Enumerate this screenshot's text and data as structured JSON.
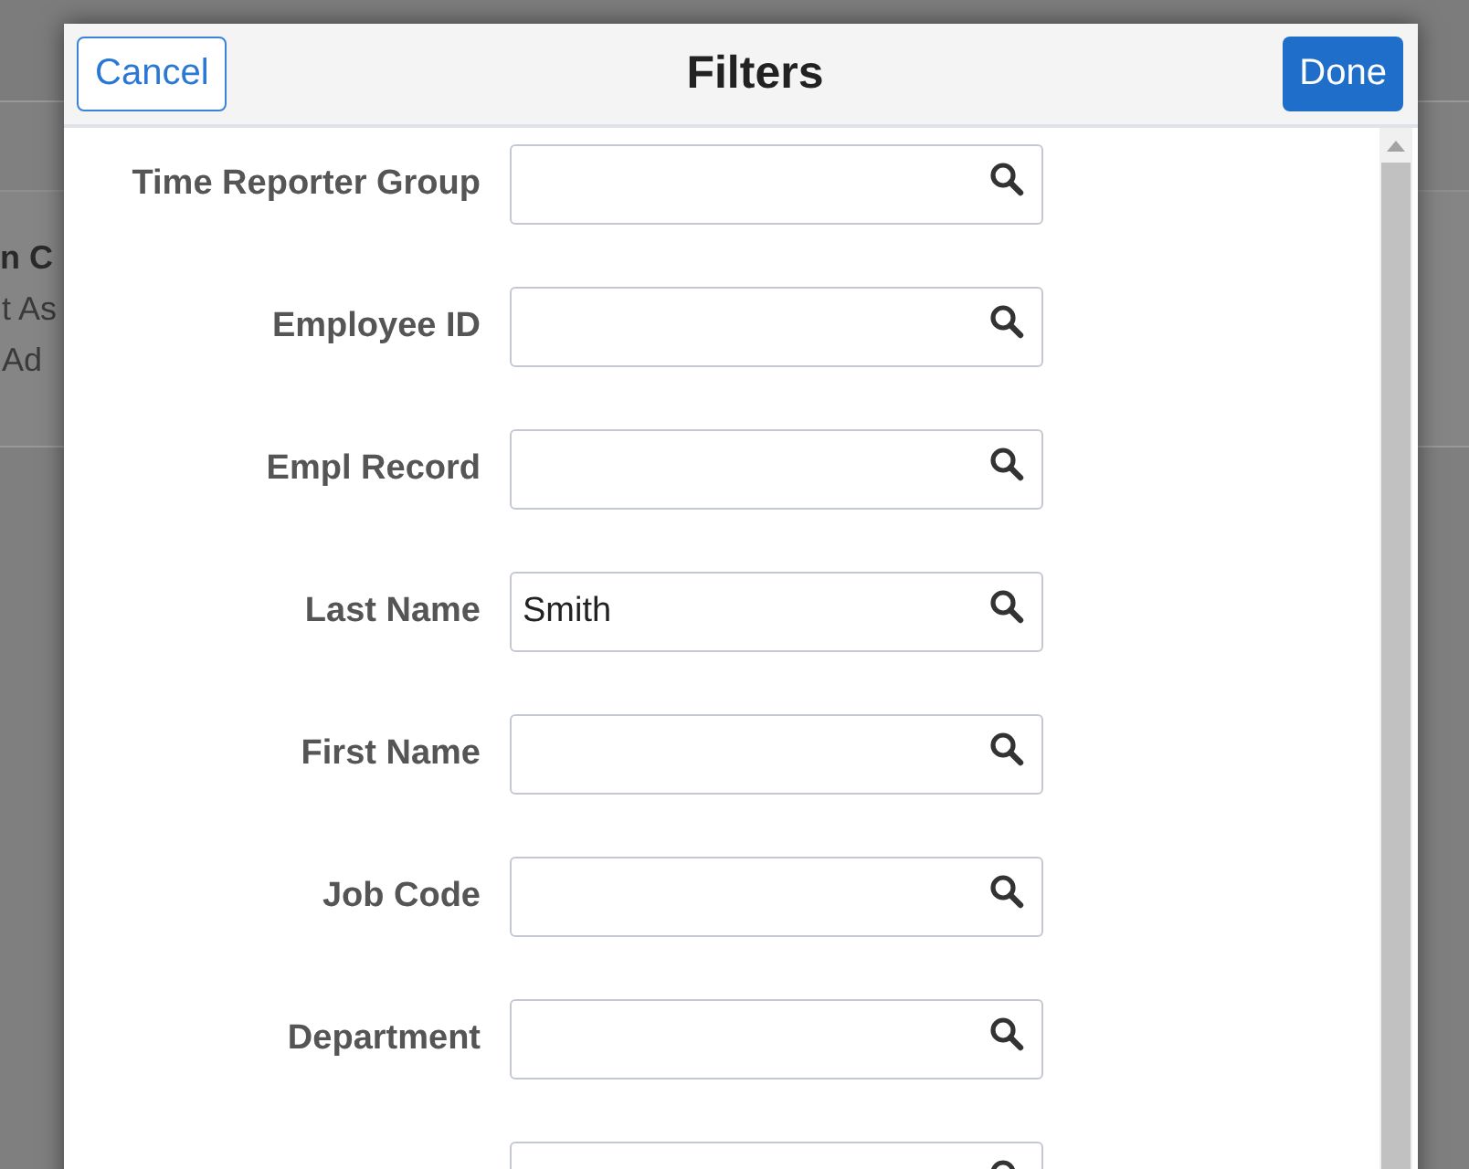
{
  "background": {
    "lines": [
      "n C",
      "t As",
      "Ad"
    ]
  },
  "dialog": {
    "title": "Filters",
    "cancel_button": "Cancel",
    "done_button": "Done",
    "fields": [
      {
        "kind": "lookup",
        "label": "Time Reporter Group"
      },
      {
        "kind": "lookup",
        "label": "Employee ID"
      },
      {
        "kind": "lookup",
        "label": "Empl Record"
      },
      {
        "kind": "lookup",
        "label": "Last Name",
        "value": "Smith"
      },
      {
        "kind": "lookup",
        "label": "First Name"
      },
      {
        "kind": "lookup",
        "label": "Job Code"
      },
      {
        "kind": "lookup",
        "label": "Department"
      },
      {
        "kind": "lookup"
      }
    ]
  }
}
